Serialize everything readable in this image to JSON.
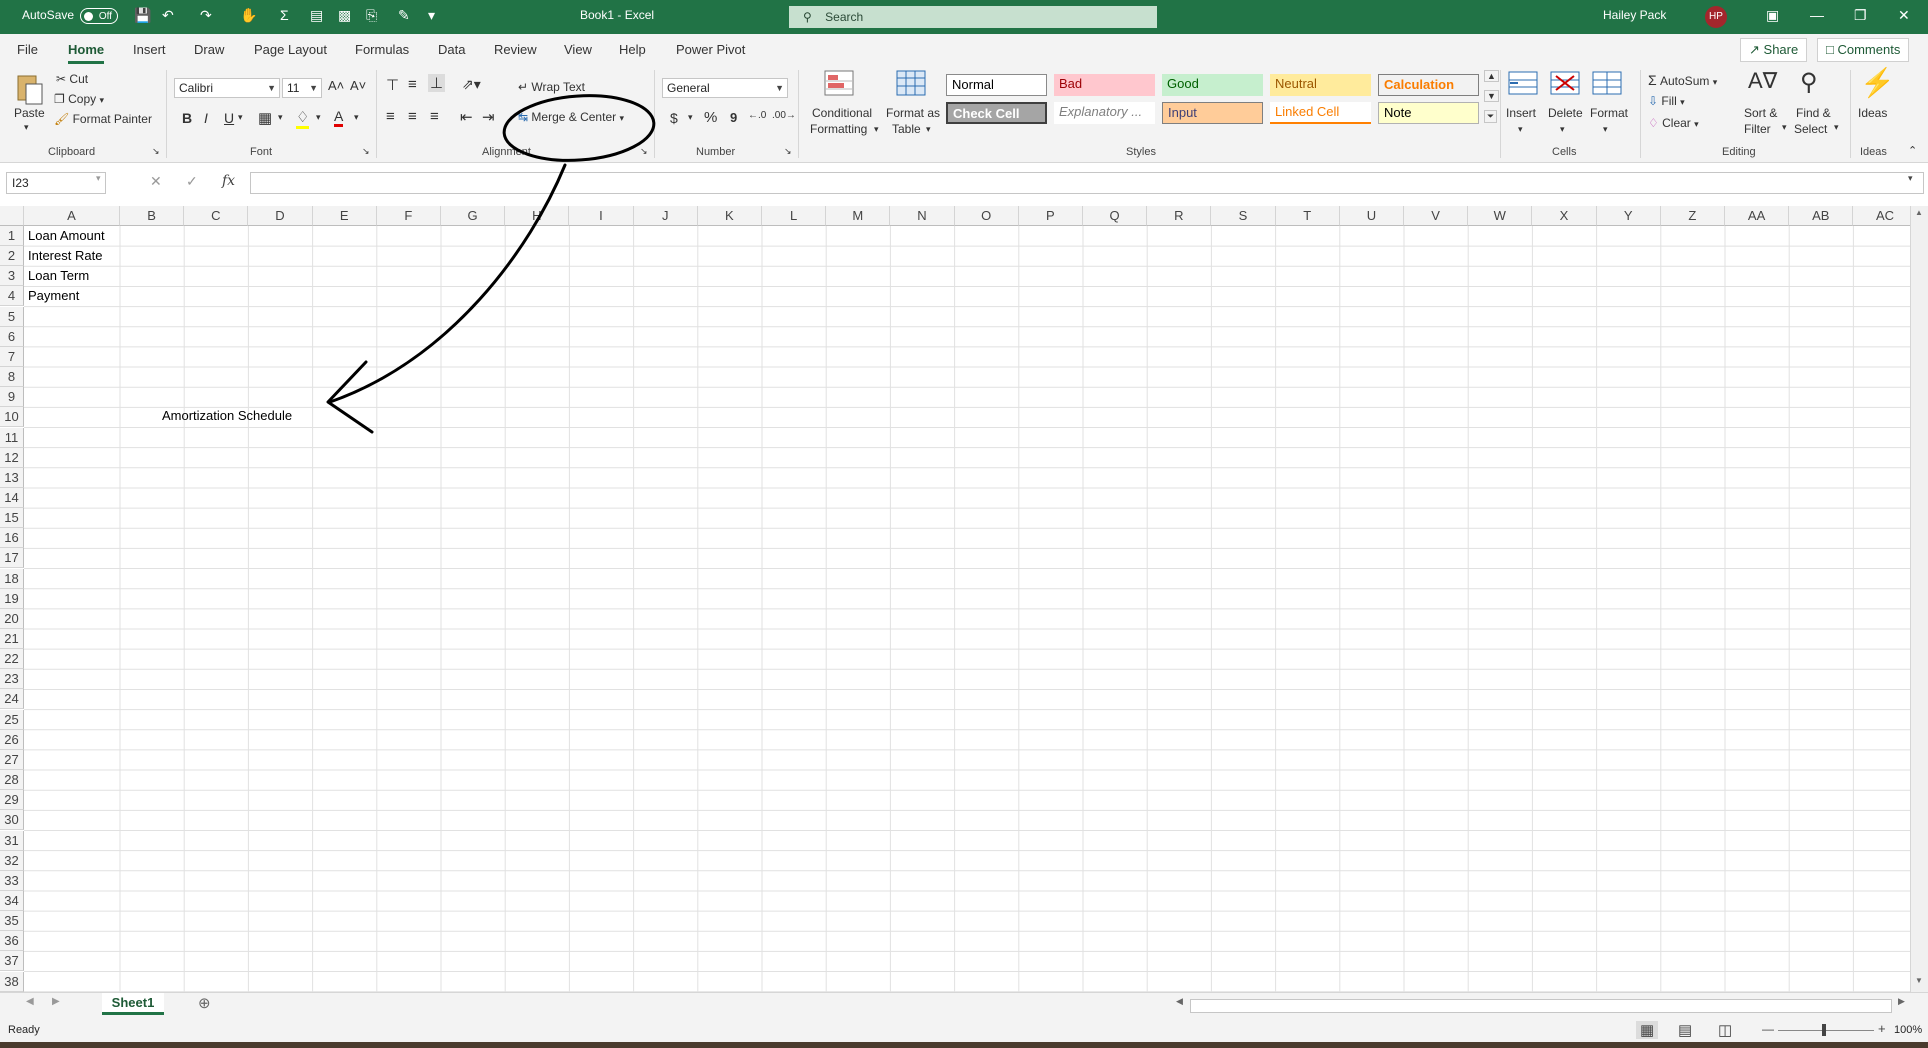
{
  "titlebar": {
    "autosave_label": "AutoSave",
    "autosave_state": "Off",
    "doc_title": "Book1  -  Excel",
    "search_placeholder": "Search",
    "user_name": "Hailey Pack",
    "user_initials": "HP"
  },
  "tabs": [
    "File",
    "Home",
    "Insert",
    "Draw",
    "Page Layout",
    "Formulas",
    "Data",
    "Review",
    "View",
    "Help",
    "Power Pivot"
  ],
  "active_tab": "Home",
  "share_label": "Share",
  "comments_label": "Comments",
  "ribbon": {
    "clipboard": {
      "label": "Clipboard",
      "paste": "Paste",
      "cut": "Cut",
      "copy": "Copy",
      "format_painter": "Format Painter"
    },
    "font": {
      "label": "Font",
      "font_name": "Calibri",
      "font_size": "11",
      "bold": "B",
      "italic": "I",
      "underline": "U"
    },
    "alignment": {
      "label": "Alignment",
      "wrap_text": "Wrap Text",
      "merge_center": "Merge & Center"
    },
    "number": {
      "label": "Number",
      "format": "General",
      "currency": "$",
      "percent": "%",
      "comma": "9"
    },
    "styles": {
      "label": "Styles",
      "conditional_formatting_1": "Conditional",
      "conditional_formatting_2": "Formatting",
      "format_as_table_1": "Format as",
      "format_as_table_2": "Table",
      "normal": "Normal",
      "bad": "Bad",
      "good": "Good",
      "neutral": "Neutral",
      "calculation": "Calculation",
      "check_cell": "Check Cell",
      "explanatory": "Explanatory ...",
      "input": "Input",
      "linked_cell": "Linked Cell",
      "note": "Note",
      "colors": {
        "normal_bg": "#ffffff",
        "bad_bg": "#ffc7ce",
        "bad_fg": "#9c0006",
        "good_bg": "#c6efce",
        "good_fg": "#006100",
        "neutral_bg": "#ffeb9c",
        "neutral_fg": "#9c5700",
        "calculation_bg": "#f2f2f2",
        "calculation_fg": "#fa7d00",
        "check_cell_bg": "#a5a5a5",
        "input_bg": "#ffcc99",
        "input_fg": "#3f3f76",
        "linked_cell_fg": "#fa7d00",
        "note_bg": "#ffffcc"
      }
    },
    "cells": {
      "label": "Cells",
      "insert": "Insert",
      "delete": "Delete",
      "format": "Format"
    },
    "editing": {
      "label": "Editing",
      "autosum": "AutoSum",
      "fill": "Fill",
      "clear": "Clear",
      "sort_filter_1": "Sort &",
      "sort_filter_2": "Filter",
      "find_select_1": "Find &",
      "find_select_2": "Select"
    },
    "ideas": {
      "label": "Ideas",
      "button": "Ideas"
    }
  },
  "formula_bar": {
    "name_box": "I23",
    "fx": "fx",
    "content": ""
  },
  "columns": [
    "A",
    "B",
    "C",
    "D",
    "E",
    "F",
    "G",
    "H",
    "I",
    "J",
    "K",
    "L",
    "M",
    "N",
    "O",
    "P",
    "Q",
    "R",
    "S",
    "T",
    "U",
    "V",
    "W",
    "X",
    "Y",
    "Z",
    "AA",
    "AB",
    "AC"
  ],
  "row_count": 38,
  "cells": {
    "A1": "Loan Amount",
    "A2": "Interest Rate",
    "A3": "Loan Term",
    "A4": "Payment",
    "C10": "Amortization Schedule"
  },
  "sheet_tab": "Sheet1",
  "status": {
    "ready": "Ready",
    "zoom": "100%"
  },
  "annotation": {
    "description_icon": "hand-drawn-circle-and-arrow"
  }
}
